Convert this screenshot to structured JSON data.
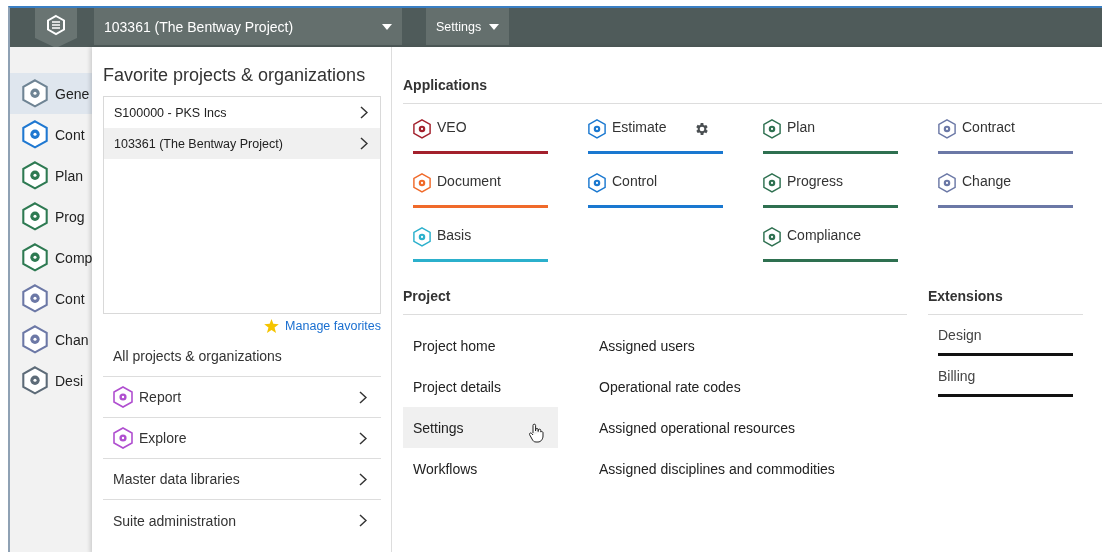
{
  "header": {
    "project_dropdown": "103361 (The Bentway Project)",
    "settings_button": "Settings"
  },
  "sidebar": {
    "items": [
      {
        "label": "Gene",
        "color": "#6f8494",
        "selected": true
      },
      {
        "label": "Cont",
        "color": "#1f78d1",
        "selected": false
      },
      {
        "label": "Plan",
        "color": "#2e7a52",
        "selected": false
      },
      {
        "label": "Prog",
        "color": "#2e7a52",
        "selected": false
      },
      {
        "label": "Comp",
        "color": "#2e7a52",
        "selected": false
      },
      {
        "label": "Cont",
        "color": "#6c78a6",
        "selected": false
      },
      {
        "label": "Chan",
        "color": "#6c78a6",
        "selected": false
      },
      {
        "label": "Desi",
        "color": "#5d6b78",
        "selected": false
      }
    ]
  },
  "favorites": {
    "title": "Favorite projects & organizations",
    "items": [
      {
        "label": "S100000 - PKS Incs",
        "selected": false
      },
      {
        "label": "103361 (The Bentway Project)",
        "selected": true
      }
    ],
    "manage_link": "Manage favorites"
  },
  "navigation": [
    {
      "label": "All projects & organizations",
      "kind": "plain"
    },
    {
      "label": "Report",
      "kind": "app",
      "color": "#b04fd0"
    },
    {
      "label": "Explore",
      "kind": "app",
      "color": "#b04fd0"
    },
    {
      "label": "Master data libraries",
      "kind": "arrow"
    },
    {
      "label": "Suite administration",
      "kind": "arrow"
    }
  ],
  "applications": {
    "title": "Applications",
    "columns": [
      [
        {
          "label": "VEO",
          "color": "#a3202c",
          "has_settings": false
        },
        {
          "label": "Document",
          "color": "#f06a2a",
          "has_settings": false
        },
        {
          "label": "Basis",
          "color": "#2bb0cc",
          "has_settings": false
        }
      ],
      [
        {
          "label": "Estimate",
          "color": "#1a78d0",
          "has_settings": true
        },
        {
          "label": "Control",
          "color": "#1a78d0",
          "has_settings": false
        }
      ],
      [
        {
          "label": "Plan",
          "color": "#2e7050",
          "has_settings": false
        },
        {
          "label": "Progress",
          "color": "#2e7050",
          "has_settings": false
        },
        {
          "label": "Compliance",
          "color": "#2e7050",
          "has_settings": false
        }
      ],
      [
        {
          "label": "Contract",
          "color": "#6b78a6",
          "has_settings": false
        },
        {
          "label": "Change",
          "color": "#6b78a6",
          "has_settings": false
        }
      ]
    ]
  },
  "project": {
    "title": "Project",
    "columns": [
      [
        {
          "label": "Project home",
          "hovered": false
        },
        {
          "label": "Project details",
          "hovered": false
        },
        {
          "label": "Settings",
          "hovered": true
        },
        {
          "label": "Workflows",
          "hovered": false
        }
      ],
      [
        {
          "label": "Assigned users",
          "hovered": false
        },
        {
          "label": "Operational rate codes",
          "hovered": false
        },
        {
          "label": "Assigned operational resources",
          "hovered": false
        },
        {
          "label": "Assigned disciplines and commodities",
          "hovered": false
        }
      ]
    ]
  },
  "extensions": {
    "title": "Extensions",
    "items": [
      {
        "label": "Design"
      },
      {
        "label": "Billing"
      }
    ]
  }
}
